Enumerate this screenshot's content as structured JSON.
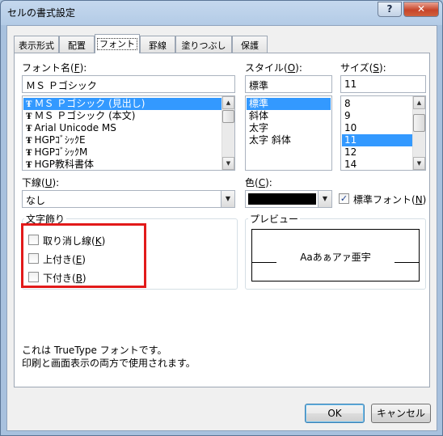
{
  "window": {
    "title": "セルの書式設定",
    "help_label": "?",
    "close_label": "✕"
  },
  "tabs": [
    {
      "label": "表示形式"
    },
    {
      "label": "配置"
    },
    {
      "label": "フォント"
    },
    {
      "label": "罫線"
    },
    {
      "label": "塗りつぶし"
    },
    {
      "label": "保護"
    }
  ],
  "active_tab": "フォント",
  "font_name": {
    "label": "フォント名(",
    "accel": "F",
    "label_end": "):",
    "value": "ＭＳ Ｐゴシック",
    "items": [
      {
        "icon": "truetype-icon",
        "label": "ＭＳ Ｐゴシック (見出し)",
        "selected": true
      },
      {
        "icon": "truetype-icon",
        "label": "ＭＳ Ｐゴシック (本文)",
        "selected": false
      },
      {
        "icon": "truetype-icon",
        "label": "Arial Unicode MS",
        "selected": false
      },
      {
        "icon": "truetype-icon",
        "label": "HGPｺﾞｼｯｸE",
        "selected": false
      },
      {
        "icon": "truetype-icon",
        "label": "HGPｺﾞｼｯｸM",
        "selected": false
      },
      {
        "icon": "truetype-icon",
        "label": "HGP教科書体",
        "selected": false
      }
    ]
  },
  "style": {
    "label": "スタイル(",
    "accel": "O",
    "label_end": "):",
    "value": "標準",
    "items": [
      {
        "label": "標準",
        "selected": true
      },
      {
        "label": "斜体",
        "selected": false
      },
      {
        "label": "太字",
        "selected": false
      },
      {
        "label": "太字 斜体",
        "selected": false
      }
    ]
  },
  "size": {
    "label": "サイズ(",
    "accel": "S",
    "label_end": "):",
    "value": "11",
    "items": [
      {
        "label": "8",
        "selected": false
      },
      {
        "label": "9",
        "selected": false
      },
      {
        "label": "10",
        "selected": false
      },
      {
        "label": "11",
        "selected": true
      },
      {
        "label": "12",
        "selected": false
      },
      {
        "label": "14",
        "selected": false
      }
    ]
  },
  "underline": {
    "label": "下線(",
    "accel": "U",
    "label_end": "):",
    "value": "なし"
  },
  "color": {
    "label": "色(",
    "accel": "C",
    "label_end": "):",
    "value": "#000000"
  },
  "normal_font": {
    "label": "標準フォント(",
    "accel": "N",
    "label_end": ")",
    "checked": true
  },
  "effects": {
    "title": "文字飾り",
    "items": [
      {
        "label": "取り消し線(",
        "accel": "K",
        "label_end": ")",
        "checked": false
      },
      {
        "label": "上付き(",
        "accel": "E",
        "label_end": ")",
        "checked": false
      },
      {
        "label": "下付き(",
        "accel": "B",
        "label_end": ")",
        "checked": false
      }
    ],
    "highlight_color": "#e21a1a"
  },
  "preview": {
    "title": "プレビュー",
    "sample": "Aaあぁアァ亜宇"
  },
  "info": {
    "line1": "これは TrueType フォントです。",
    "line2": "印刷と画面表示の両方で使用されます。"
  },
  "buttons": {
    "ok": "OK",
    "cancel": "キャンセル"
  },
  "colors": {
    "selection": "#3399ff",
    "title_bar": "#b3cbe6",
    "highlight": "#e21a1a"
  }
}
